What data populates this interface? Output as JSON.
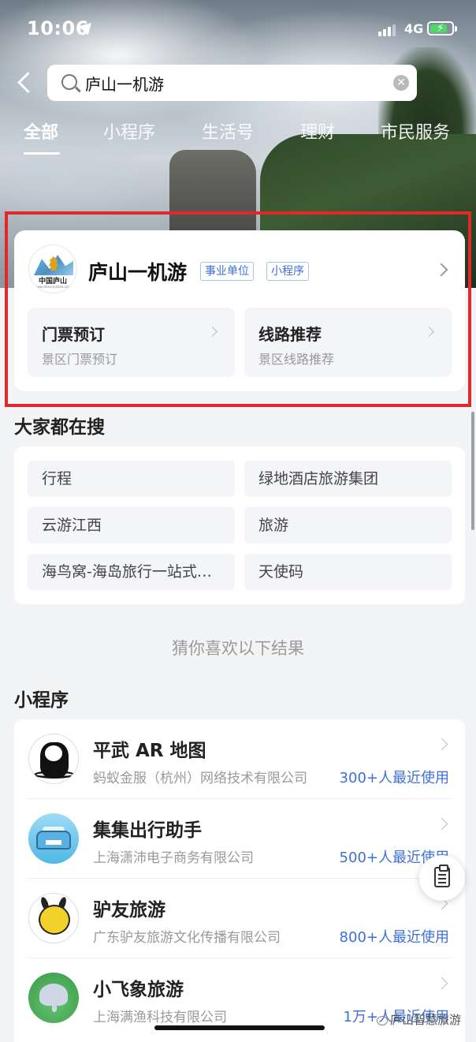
{
  "status_bar": {
    "time": "10:06",
    "network": "4G",
    "battery_level": 0.8
  },
  "search": {
    "query": "庐山一机游",
    "placeholder": ""
  },
  "tabs": [
    {
      "label": "全部",
      "active": true
    },
    {
      "label": "小程序",
      "active": false
    },
    {
      "label": "生活号",
      "active": false
    },
    {
      "label": "理财",
      "active": false
    },
    {
      "label": "市民服务",
      "active": false
    }
  ],
  "top_result": {
    "logo_text": "中国庐山",
    "logo_url": "www.china-lushan.com",
    "title": "庐山一机游",
    "tags": [
      "事业单位",
      "小程序"
    ],
    "sub_items": [
      {
        "title": "门票预订",
        "subtitle": "景区门票预订"
      },
      {
        "title": "线路推荐",
        "subtitle": "景区线路推荐"
      }
    ]
  },
  "hot_search": {
    "title": "大家都在搜",
    "items": [
      "行程",
      "绿地酒店旅游集团",
      "云游江西",
      "旅游",
      "海鸟窝-海岛旅行一站式服务",
      "天使码"
    ]
  },
  "guess_text": "猜你喜欢以下结果",
  "mini_programs": {
    "title": "小程序",
    "items": [
      {
        "name": "平武 AR 地图",
        "company": "蚂蚁金服（杭州）网络技术有限公司",
        "users": "300+人最近使用",
        "icon": "panda-icon"
      },
      {
        "name": "集集出行助手",
        "company": "上海潇沛电子商务有限公司",
        "users": "500+人最近使用",
        "icon": "car-icon"
      },
      {
        "name": "驴友旅游",
        "company": "广东驴友旅游文化传播有限公司",
        "users": "800+人最近使用",
        "icon": "donkey-icon"
      },
      {
        "name": "小飞象旅游",
        "company": "上海满渔科技有限公司",
        "users": "1万+人最近使用",
        "icon": "elephant-icon"
      }
    ]
  },
  "watermark": "庐山智慧旅游",
  "colors": {
    "accent": "#3e6fd8",
    "highlight_border": "#e02a2a",
    "page_bg": "#f3f4f6"
  }
}
